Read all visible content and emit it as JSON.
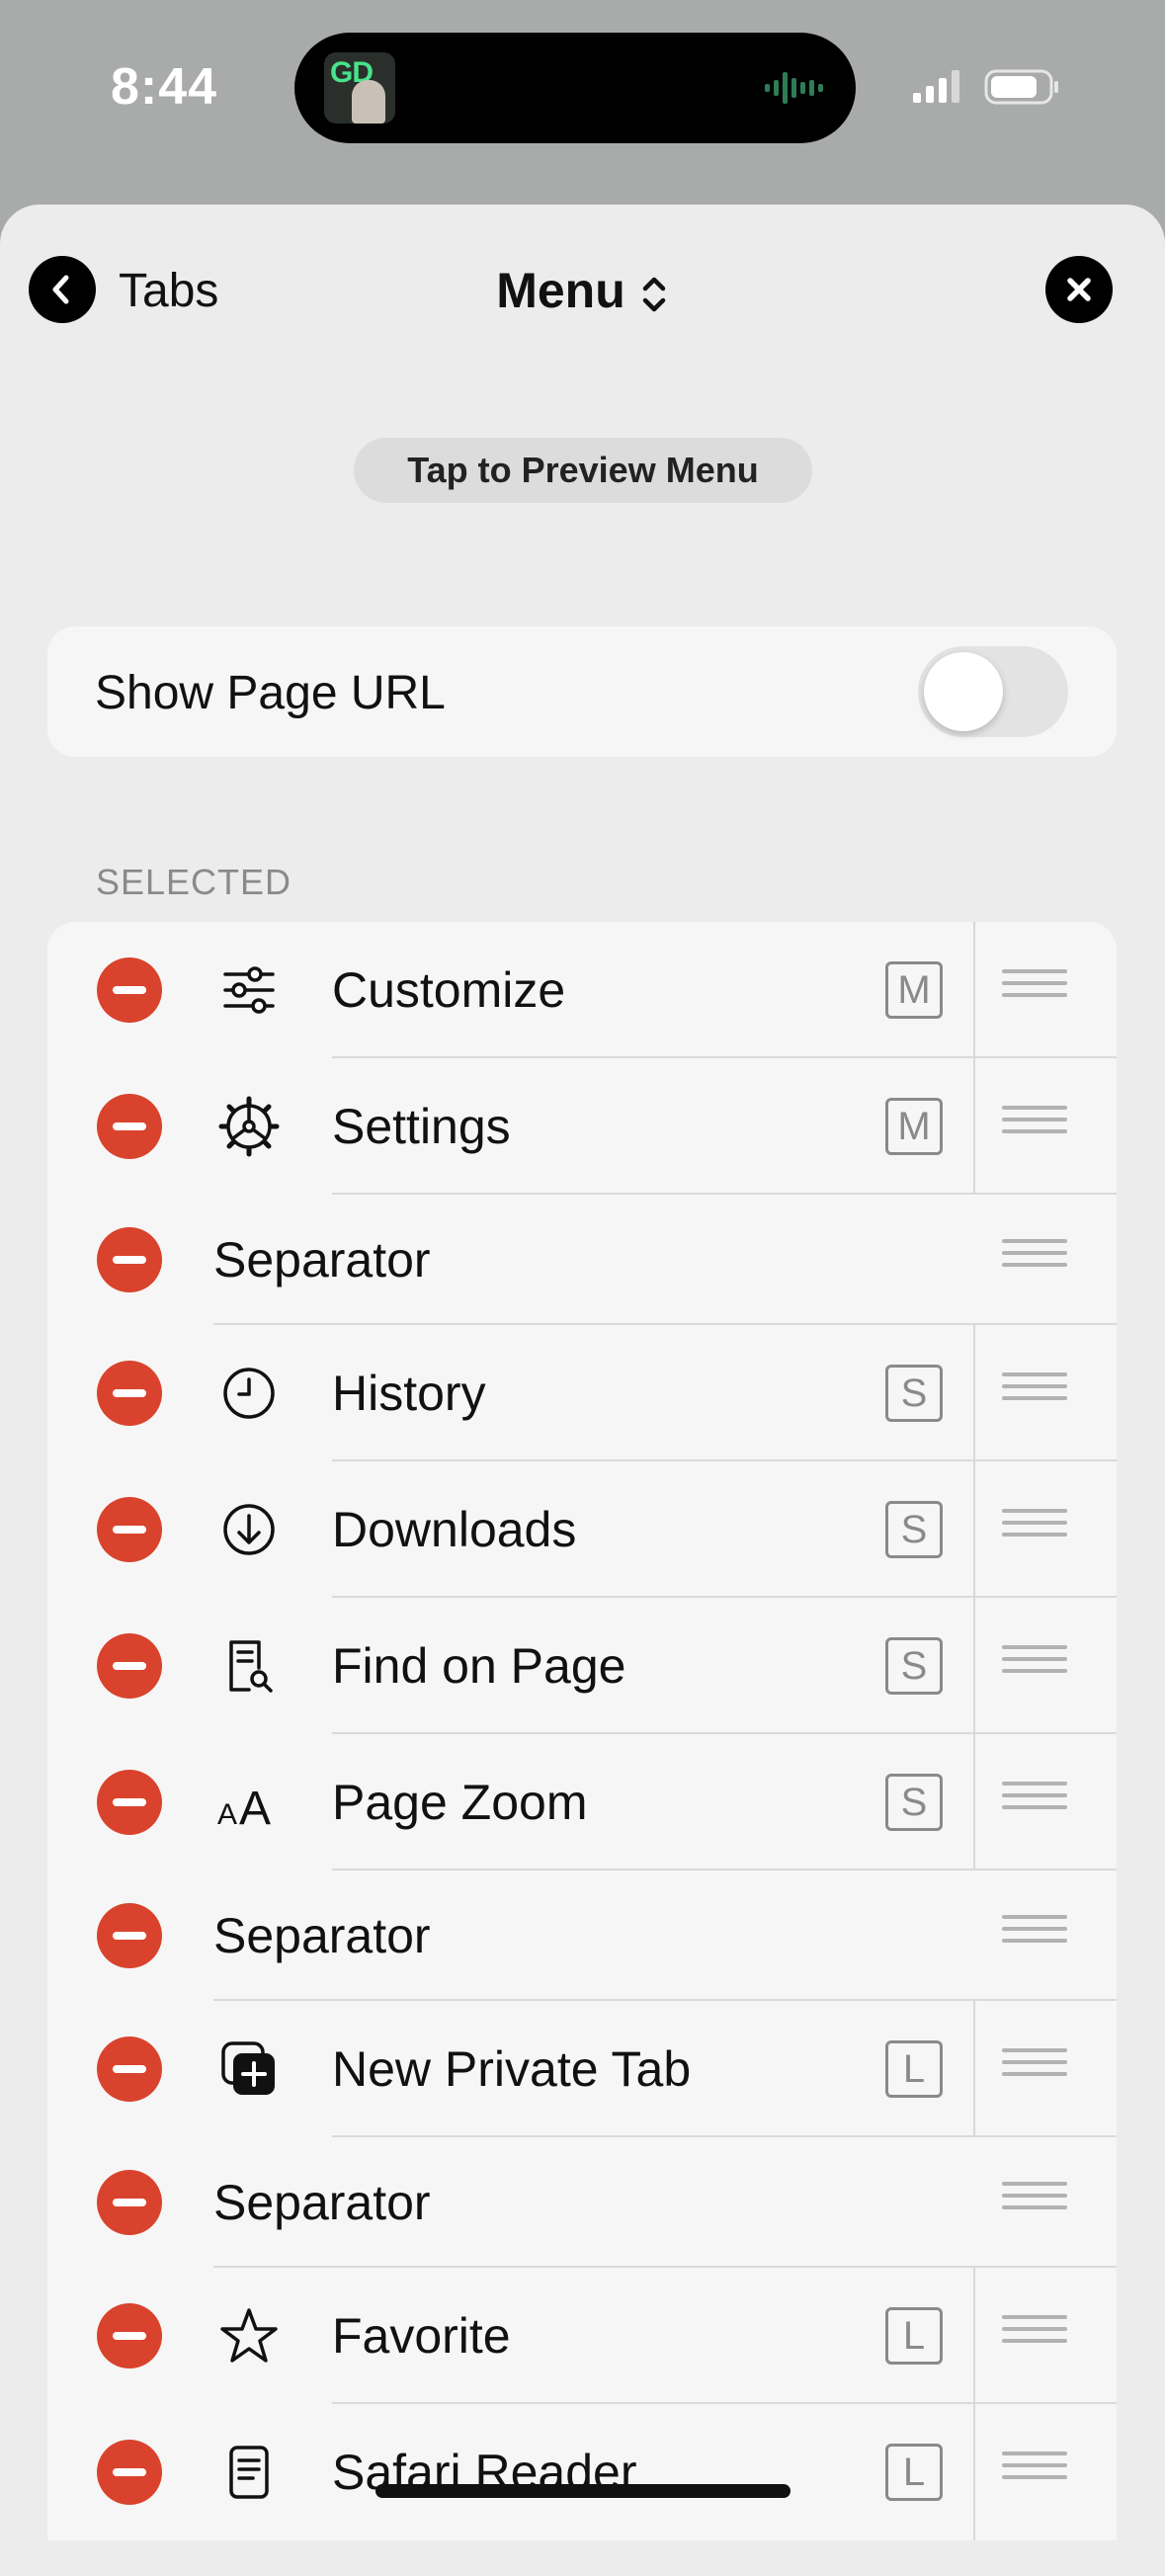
{
  "status_bar": {
    "time": "8:44",
    "now_playing_art_text": "GD"
  },
  "nav": {
    "back_label": "Tabs",
    "title": "Menu",
    "preview_button": "Tap to Preview Menu"
  },
  "url_setting": {
    "label": "Show Page URL",
    "enabled": false
  },
  "section": {
    "header": "SELECTED"
  },
  "items": [
    {
      "label": "Customize",
      "icon": "sliders-icon",
      "badge": "M",
      "type": "item"
    },
    {
      "label": "Settings",
      "icon": "gear-icon",
      "badge": "M",
      "type": "item"
    },
    {
      "label": "Separator",
      "type": "separator"
    },
    {
      "label": "History",
      "icon": "clock-icon",
      "badge": "S",
      "type": "item"
    },
    {
      "label": "Downloads",
      "icon": "download-circle-icon",
      "badge": "S",
      "type": "item"
    },
    {
      "label": "Find on Page",
      "icon": "find-on-page-icon",
      "badge": "S",
      "type": "item"
    },
    {
      "label": "Page Zoom",
      "icon": "text-size-icon",
      "badge": "S",
      "type": "item"
    },
    {
      "label": "Separator",
      "type": "separator"
    },
    {
      "label": "New Private Tab",
      "icon": "new-tab-icon",
      "badge": "L",
      "type": "item"
    },
    {
      "label": "Separator",
      "type": "separator"
    },
    {
      "label": "Favorite",
      "icon": "star-icon",
      "badge": "L",
      "type": "item"
    },
    {
      "label": "Safari Reader",
      "icon": "reader-icon",
      "badge": "L",
      "type": "item"
    }
  ],
  "colors": {
    "remove": "#d9432d",
    "background": "#ececec",
    "card": "#f6f6f6"
  }
}
